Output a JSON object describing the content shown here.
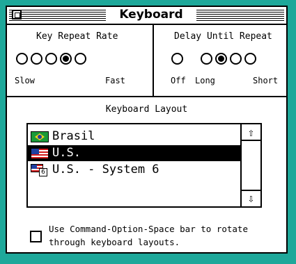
{
  "window": {
    "title": "Keyboard"
  },
  "key_repeat": {
    "title": "Key Repeat Rate",
    "left_label": "Slow",
    "right_label": "Fast",
    "selected_index": 3,
    "option_count": 5
  },
  "delay": {
    "title": "Delay Until Repeat",
    "labels": [
      "Off",
      "Long",
      "Short"
    ],
    "selected_index": 2,
    "option_count": 5
  },
  "layout": {
    "title": "Keyboard Layout",
    "items": [
      {
        "label": "Brasil",
        "icon": "brazil-flag-icon",
        "selected": false
      },
      {
        "label": "U.S.",
        "icon": "us-flag-icon",
        "selected": true
      },
      {
        "label": "U.S. - System 6",
        "icon": "us-system6-flag-icon",
        "selected": false
      }
    ]
  },
  "rotate_option": {
    "label": "Use Command-Option-Space bar to rotate through keyboard layouts.",
    "checked": false
  },
  "colors": {
    "desktop": "#1ea89a",
    "selection": "#000000"
  }
}
